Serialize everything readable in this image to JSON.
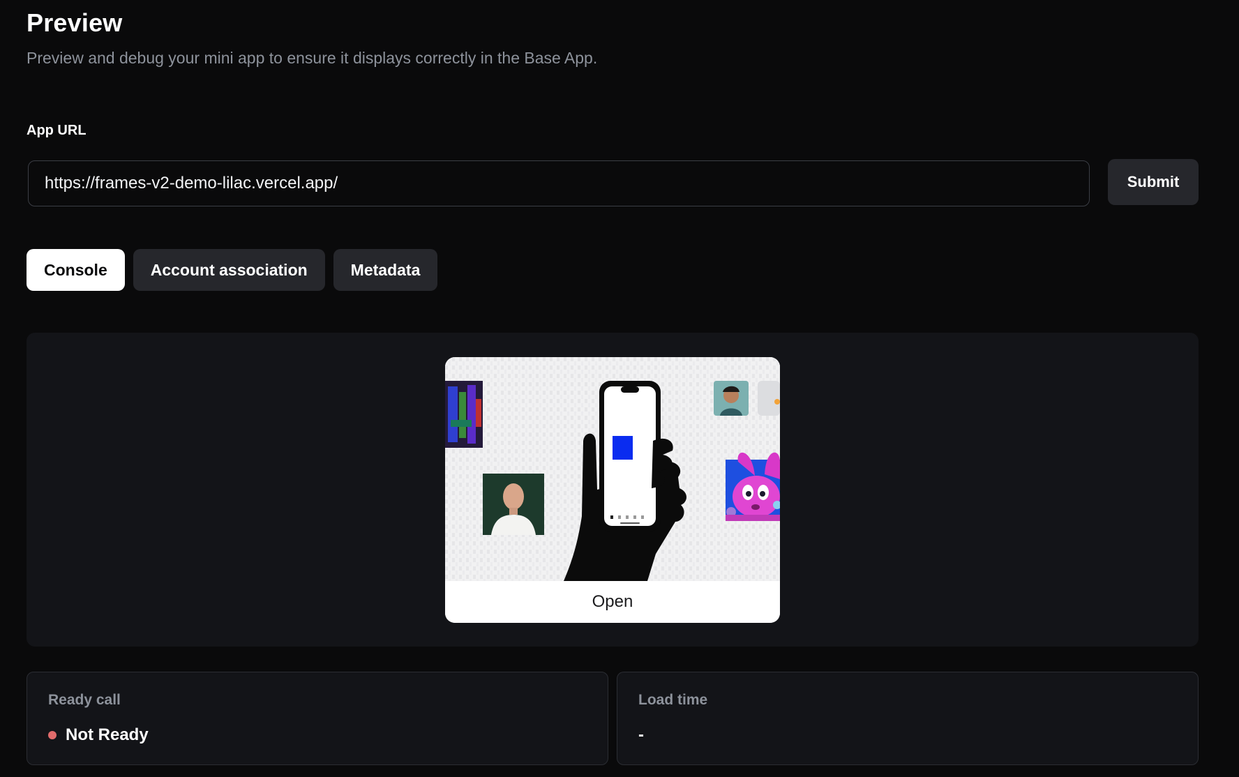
{
  "header": {
    "title": "Preview",
    "subtitle": "Preview and debug your mini app to ensure it displays correctly in the Base App."
  },
  "url_form": {
    "label": "App URL",
    "value": "https://frames-v2-demo-lilac.vercel.app/",
    "submit_label": "Submit"
  },
  "tabs": [
    {
      "label": "Console",
      "active": true
    },
    {
      "label": "Account association",
      "active": false
    },
    {
      "label": "Metadata",
      "active": false
    }
  ],
  "embed": {
    "button_label": "Open",
    "image_icons": [
      "hand-holding-phone-icon",
      "portrait-photo-icon",
      "avatar-photo-icon",
      "bunny-artwork-icon",
      "glitch-artwork-icon"
    ]
  },
  "stats": {
    "ready_call": {
      "label": "Ready call",
      "value": "Not Ready",
      "dot_color": "#e06b6b"
    },
    "load_time": {
      "label": "Load time",
      "value": "-"
    }
  },
  "colors": {
    "background": "#0a0a0b",
    "panel": "#131418",
    "button": "#26272c",
    "muted_text": "#8d929b",
    "accent_blue": "#0a2cf0"
  }
}
